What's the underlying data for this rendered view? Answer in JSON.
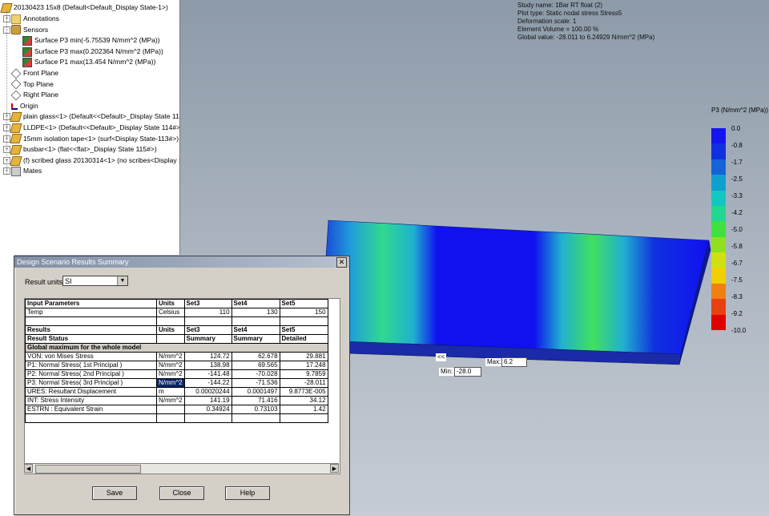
{
  "tree": {
    "root": "20130423 15x8  (Default<Default_Display State-1>)",
    "items": [
      {
        "label": "Annotations"
      },
      {
        "label": "Sensors"
      },
      {
        "label": "Surface P3 min(-5.75539 N/mm^2 (MPa))"
      },
      {
        "label": "Surface P3 max(0.202364 N/mm^2 (MPa))"
      },
      {
        "label": "Surface P1 max(13.454 N/mm^2 (MPa))"
      },
      {
        "label": "Front Plane"
      },
      {
        "label": "Top Plane"
      },
      {
        "label": "Right Plane"
      },
      {
        "label": "Origin"
      },
      {
        "label": "plain glass<1> (Default<<Default>_Display State 11"
      },
      {
        "label": "LLDPE<1> (Default<<Default>_Display State 114#>)"
      },
      {
        "label": "15mm isolation tape<1> (surf<Display State-113#>)"
      },
      {
        "label": "busbar<1> (flat<<flat>_Display State 115#>)"
      },
      {
        "label": "(f) scribed glass 20130314<1> (no scribes<Display S"
      },
      {
        "label": "Mates"
      }
    ]
  },
  "study": {
    "lines": [
      "Study name: 1Bar RT float (2)",
      "Plot type: Static nodal stress Stress5",
      "Deformation scale: 1",
      "Element Volume = 100.00 %",
      "Global value: -28.011 to 6.24929 N/mm^2 (MPa)"
    ]
  },
  "legend": {
    "title": "P3 (N/mm^2 (MPa))",
    "labels": [
      "0.0",
      "-0.8",
      "-1.7",
      "-2.5",
      "-3.3",
      "-4.2",
      "-5.0",
      "-5.8",
      "-6.7",
      "-7.5",
      "-8.3",
      "-9.2",
      "-10.0"
    ],
    "colors": [
      "#1414f0",
      "#1030e0",
      "#1464d8",
      "#10a0d0",
      "#10c8c0",
      "#20d890",
      "#40e040",
      "#90e020",
      "#d0e010",
      "#f0d000",
      "#f08010",
      "#e84010",
      "#e00000"
    ]
  },
  "plot_tags": {
    "max_label": "Max:",
    "max_value": "6.2",
    "min_label": "Min:",
    "min_value": "-28.0",
    "marker": "<<"
  },
  "dialog": {
    "title": "Design Scenario Results Summary",
    "close": "✕",
    "units_label": "Result units:",
    "units_value": "SI",
    "save": "Save",
    "close_button": "Close",
    "help": "Help",
    "rows": [
      {
        "type": "hdr",
        "cells": [
          "Input Parameters",
          "Units",
          "Set3",
          "Set4",
          "Set5"
        ]
      },
      {
        "type": "row",
        "cells": [
          "Temp",
          "Celsius",
          "110",
          "130",
          "150"
        ]
      },
      {
        "type": "row",
        "cells": [
          "",
          "",
          "",
          "",
          ""
        ]
      },
      {
        "type": "hdr",
        "cells": [
          "Results",
          "Units",
          "Set3",
          "Set4",
          "Set5"
        ]
      },
      {
        "type": "hdr",
        "cells": [
          "Result Status",
          "",
          "Summary",
          "Summary",
          "Detailed"
        ]
      },
      {
        "type": "band",
        "cells": [
          "Global maximum for the whole model",
          "",
          "",
          "",
          ""
        ]
      },
      {
        "type": "row",
        "cells": [
          "VON:    von Mises Stress",
          "N/mm^2",
          "124.72",
          "62.678",
          "29.881"
        ]
      },
      {
        "type": "row",
        "cells": [
          "P1:     Normal Stress( 1st Principal )",
          "N/mm^2",
          "138.98",
          "69.565",
          "17.248"
        ]
      },
      {
        "type": "row",
        "cells": [
          "P2:     Normal Stress( 2nd Principal )",
          "N/mm^2",
          "-141.48",
          "-70.028",
          "9.7859"
        ]
      },
      {
        "type": "row",
        "cells": [
          "P3:     Normal Stress( 3rd Principal )",
          "N/mm^2",
          "-144.22",
          "-71.536",
          "-28.011"
        ],
        "selected": 1
      },
      {
        "type": "row",
        "cells": [
          "URES:   Resultant Displacement",
          "m",
          "0.00020244",
          "0.0001497",
          "9.8773E-005"
        ]
      },
      {
        "type": "row",
        "cells": [
          "INT:    Stress Intensity",
          "N/mm^2",
          "141.19",
          "71.416",
          "34.12"
        ]
      },
      {
        "type": "row",
        "cells": [
          "ESTRN :   Equivalent Strain",
          "",
          "0.34924",
          "0.73103",
          "1.42"
        ]
      },
      {
        "type": "row",
        "cells": [
          "",
          "",
          "",
          "",
          ""
        ]
      }
    ]
  }
}
